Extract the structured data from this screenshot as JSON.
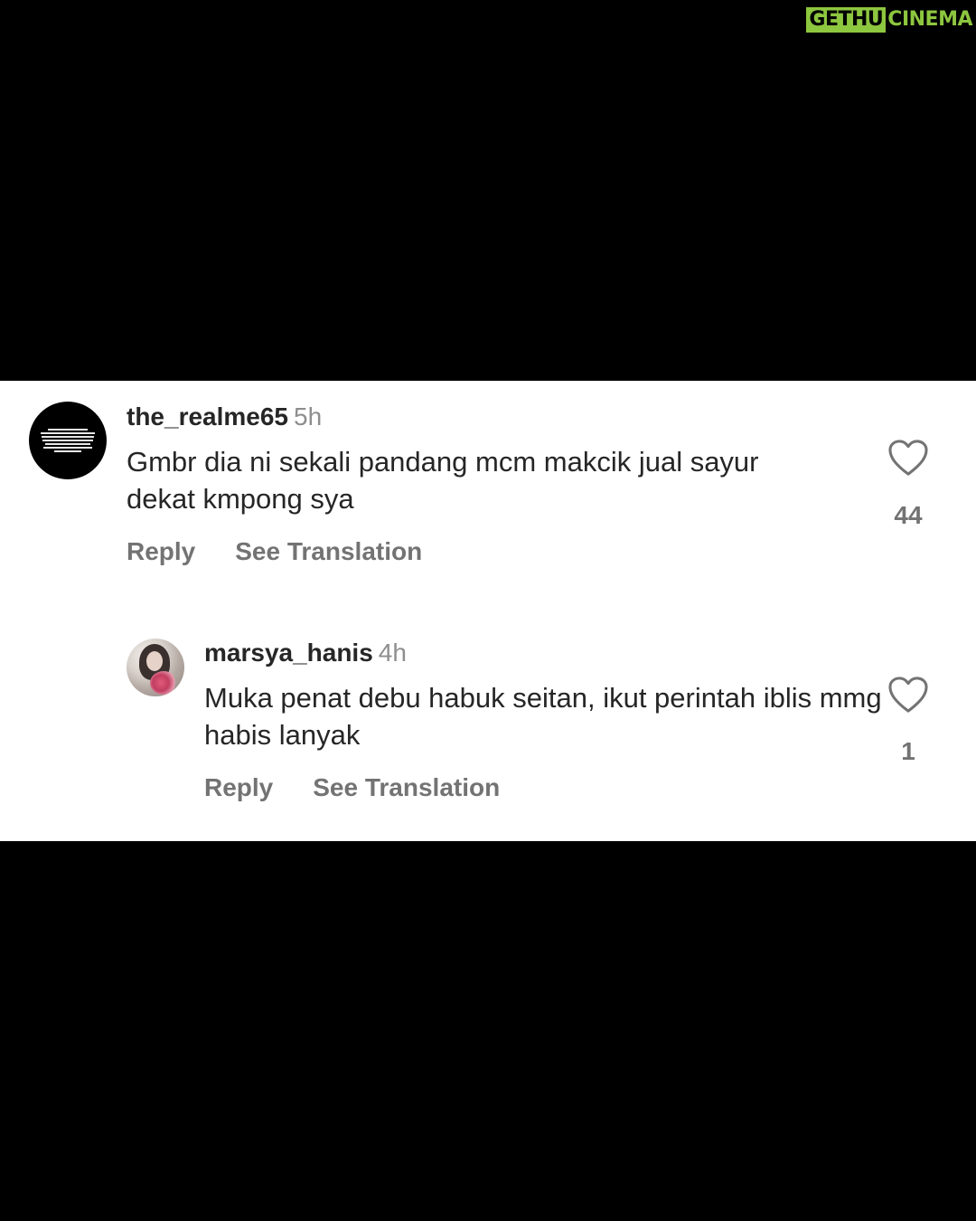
{
  "watermark": {
    "boxed": "GETHU",
    "tail": "CINEMA"
  },
  "comments": [
    {
      "username": "the_realme65",
      "time": "5h",
      "text": "Gmbr dia ni sekali pandang mcm makcik jual sayur dekat kmpong sya",
      "reply_label": "Reply",
      "translate_label": "See Translation",
      "likes": "44",
      "avatar": "black-text-avatar"
    },
    {
      "username": "marsya_hanis",
      "time": "4h",
      "text": "Muka penat debu habuk seitan, ikut perintah iblis mmg habis lanyak",
      "reply_label": "Reply",
      "translate_label": "See Translation",
      "likes": "1",
      "avatar": "photo-avatar"
    }
  ],
  "icons": {
    "like": "heart-outline-icon"
  },
  "colors": {
    "background": "#000000",
    "panel": "#ffffff",
    "text": "#262626",
    "muted": "#737373",
    "watermark": "#8dc63f"
  }
}
